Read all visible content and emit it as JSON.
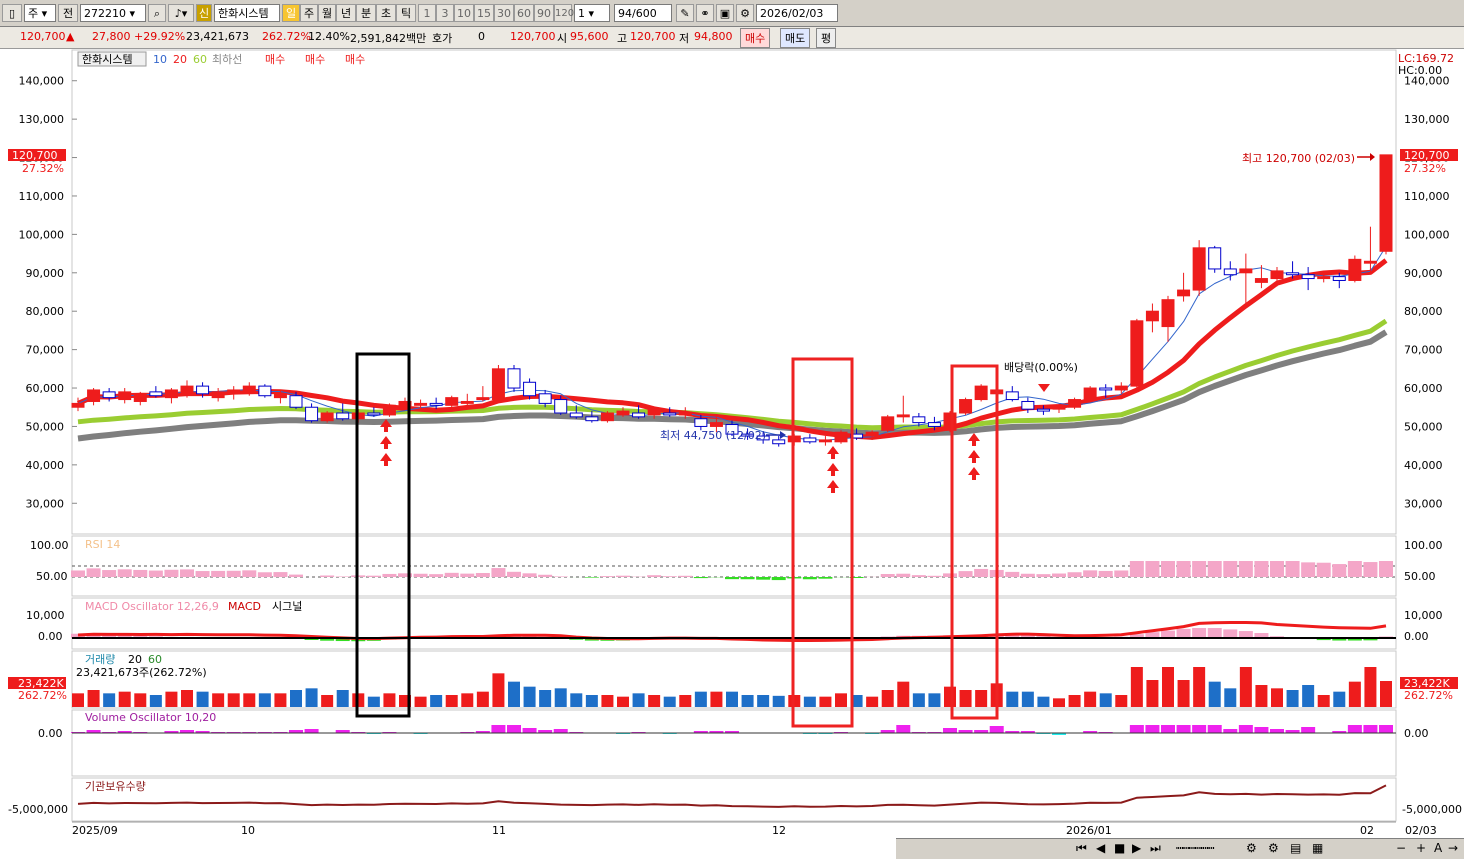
{
  "toolbar": {
    "period": "주",
    "prev_label": "전",
    "code": "272210",
    "stock_name": "한화시스템",
    "new_badge": "신",
    "period_tabs": [
      "일",
      "주",
      "월",
      "년",
      "분",
      "초",
      "틱"
    ],
    "interval_buttons": [
      "1",
      "3",
      "10",
      "15",
      "30",
      "60",
      "90",
      "120"
    ],
    "count_value": "1",
    "bar_count": "94",
    "bar_total": "/600",
    "date": "2026/02/03"
  },
  "info": {
    "price": "120,700",
    "change": "27,800",
    "change_pct": "+29.92%",
    "volume": "23,421,673",
    "vol_ratio": "262.72%",
    "turnover": "12.40%",
    "amount": "2,591,842백만",
    "bid_label": "호가",
    "bid_qty": "0",
    "bid_price": "120,700",
    "open_label": "시",
    "open": "95,600",
    "high_label": "고",
    "high": "120,700",
    "low_label": "저",
    "low": "94,800",
    "buy_button": "매수",
    "sell_button": "매도",
    "eval_button": "평"
  },
  "legend": {
    "name": "한화시스템",
    "ma10": "10",
    "ma20": "20",
    "ma60": "60",
    "lowline": "최하선",
    "signals": [
      "매수",
      "매수",
      "매수"
    ]
  },
  "right_info": {
    "lc": "LC:169.72",
    "hc": "HC:0.00"
  },
  "price_tag": {
    "price": "120,700",
    "pct": "27.32%"
  },
  "annotations": {
    "high_label": "최고 120,700 (02/03)",
    "low_label": "최저 44,750 (12/02)",
    "dividend_label": "배당락(0.00%)"
  },
  "panels": {
    "rsi": {
      "label": "RSI 14",
      "ticks": [
        "100.00",
        "50.00"
      ]
    },
    "macd": {
      "label": "MACD Oscillator 12,26,9",
      "macd_label": "MACD",
      "signal_label": "시그널",
      "ticks": [
        "10,000",
        "0.00"
      ]
    },
    "volume": {
      "label": "거래량",
      "ma20": "20",
      "ma60": "60",
      "value_line": "23,421,673주(262.72%)",
      "tag_value": "23,422K",
      "tag_pct": "262.72%"
    },
    "vosc": {
      "label": "Volume Oscillator 10,20",
      "ticks": [
        "0.00"
      ]
    },
    "inst": {
      "label": "기관보유수량",
      "ticks": [
        "-5,000,000"
      ]
    }
  },
  "x_labels": [
    "2025/09",
    "10",
    "11",
    "12",
    "2026/01",
    "02",
    "02/03"
  ],
  "colors": {
    "up": "#ee1c1c",
    "down": "#0000cc",
    "ma20": "#ee1c1c",
    "ma60": "#9acd32",
    "lowline": "#7f7f7f",
    "rsi_up": "#f4a6c8",
    "rsi_down": "#33dd22",
    "vosc_up": "#ee22ee",
    "vosc_down": "#22eeee",
    "inst": "#8b1a1a",
    "box_black": "#000000",
    "box_red": "#ee2222"
  },
  "chart_data": {
    "type": "candlestick",
    "y_ticks": [
      30000,
      40000,
      50000,
      60000,
      70000,
      80000,
      90000,
      100000,
      110000,
      120000,
      130000,
      140000
    ],
    "ylim": [
      22000,
      148000
    ],
    "bars": [
      [
        55000,
        57500,
        54000,
        56000
      ],
      [
        56500,
        60000,
        55500,
        59500
      ],
      [
        59000,
        60000,
        56500,
        57500
      ],
      [
        57000,
        60000,
        56000,
        59000
      ],
      [
        56500,
        59000,
        55500,
        58500
      ],
      [
        59000,
        60500,
        57500,
        58000
      ],
      [
        57500,
        60000,
        56000,
        59500
      ],
      [
        58500,
        62000,
        57500,
        60500
      ],
      [
        60500,
        61500,
        57500,
        58500
      ],
      [
        57500,
        60000,
        56500,
        59000
      ],
      [
        58500,
        60500,
        57000,
        59500
      ],
      [
        59000,
        61500,
        58000,
        60500
      ],
      [
        60500,
        61000,
        57500,
        58000
      ],
      [
        57500,
        59500,
        56000,
        58500
      ],
      [
        58000,
        59000,
        54500,
        55000
      ],
      [
        55000,
        56000,
        51000,
        51500
      ],
      [
        51500,
        54000,
        51000,
        53500
      ],
      [
        53500,
        56000,
        51500,
        52000
      ],
      [
        52000,
        54500,
        51000,
        53500
      ],
      [
        53500,
        55000,
        52500,
        53000
      ],
      [
        53000,
        56000,
        52500,
        55500
      ],
      [
        55000,
        57500,
        54500,
        56500
      ],
      [
        55500,
        57000,
        54500,
        56000
      ],
      [
        56000,
        57500,
        54500,
        55500
      ],
      [
        55500,
        58000,
        55000,
        57500
      ],
      [
        56000,
        58500,
        55000,
        56500
      ],
      [
        57000,
        60500,
        56500,
        57500
      ],
      [
        57000,
        66000,
        56500,
        65000
      ],
      [
        65000,
        66000,
        59000,
        60000
      ],
      [
        61500,
        62500,
        57000,
        58000
      ],
      [
        58500,
        59500,
        55000,
        56000
      ],
      [
        57000,
        58000,
        53000,
        53500
      ],
      [
        53500,
        55500,
        52000,
        52500
      ],
      [
        52500,
        54000,
        51000,
        51500
      ],
      [
        51500,
        54000,
        51000,
        53500
      ],
      [
        53000,
        55000,
        52500,
        54000
      ],
      [
        53500,
        55500,
        52000,
        52500
      ],
      [
        53000,
        55000,
        52000,
        54500
      ],
      [
        53500,
        55000,
        52500,
        53000
      ],
      [
        53000,
        55000,
        52000,
        53500
      ],
      [
        52000,
        53000,
        49000,
        50000
      ],
      [
        50000,
        52500,
        48500,
        51000
      ],
      [
        50500,
        51500,
        47500,
        48000
      ],
      [
        48000,
        49500,
        46500,
        47500
      ],
      [
        47500,
        48500,
        45500,
        46500
      ],
      [
        46500,
        47500,
        44750,
        45500
      ],
      [
        46000,
        48000,
        45000,
        47500
      ],
      [
        47000,
        48000,
        45500,
        46000
      ],
      [
        46000,
        47500,
        45000,
        46500
      ],
      [
        46000,
        49000,
        45500,
        48500
      ],
      [
        48000,
        49500,
        46500,
        47000
      ],
      [
        47500,
        49000,
        46500,
        48500
      ],
      [
        49000,
        53000,
        48500,
        52500
      ],
      [
        52500,
        58000,
        51000,
        53000
      ],
      [
        52500,
        53500,
        50000,
        51000
      ],
      [
        51000,
        52500,
        49000,
        50000
      ],
      [
        49000,
        54000,
        48500,
        53500
      ],
      [
        53500,
        57500,
        53000,
        57000
      ],
      [
        57000,
        61000,
        56500,
        60500
      ],
      [
        58500,
        64000,
        57500,
        59500
      ],
      [
        59000,
        60500,
        56500,
        57000
      ],
      [
        56500,
        57500,
        53500,
        54500
      ],
      [
        54500,
        55500,
        53000,
        54000
      ],
      [
        54500,
        55500,
        53500,
        55000
      ],
      [
        55000,
        57500,
        54500,
        57000
      ],
      [
        57000,
        60500,
        56500,
        60000
      ],
      [
        60000,
        61000,
        57500,
        59500
      ],
      [
        59500,
        61500,
        58500,
        60500
      ],
      [
        60500,
        78000,
        60000,
        77500
      ],
      [
        77500,
        82000,
        74500,
        80000
      ],
      [
        76000,
        84000,
        72000,
        83000
      ],
      [
        84000,
        90000,
        82500,
        85500
      ],
      [
        85500,
        98500,
        84000,
        96500
      ],
      [
        96500,
        97000,
        90000,
        91000
      ],
      [
        91000,
        93000,
        88000,
        89500
      ],
      [
        90000,
        95000,
        81000,
        91000
      ],
      [
        87500,
        92000,
        86000,
        88500
      ],
      [
        88500,
        91500,
        86500,
        90500
      ],
      [
        90000,
        93000,
        88500,
        89500
      ],
      [
        89500,
        91500,
        85500,
        88500
      ],
      [
        88500,
        90500,
        87500,
        89000
      ],
      [
        89000,
        90000,
        86000,
        88000
      ],
      [
        88000,
        94500,
        87500,
        93500
      ],
      [
        92500,
        102000,
        90000,
        93000
      ],
      [
        95600,
        120700,
        94800,
        120700
      ]
    ]
  }
}
